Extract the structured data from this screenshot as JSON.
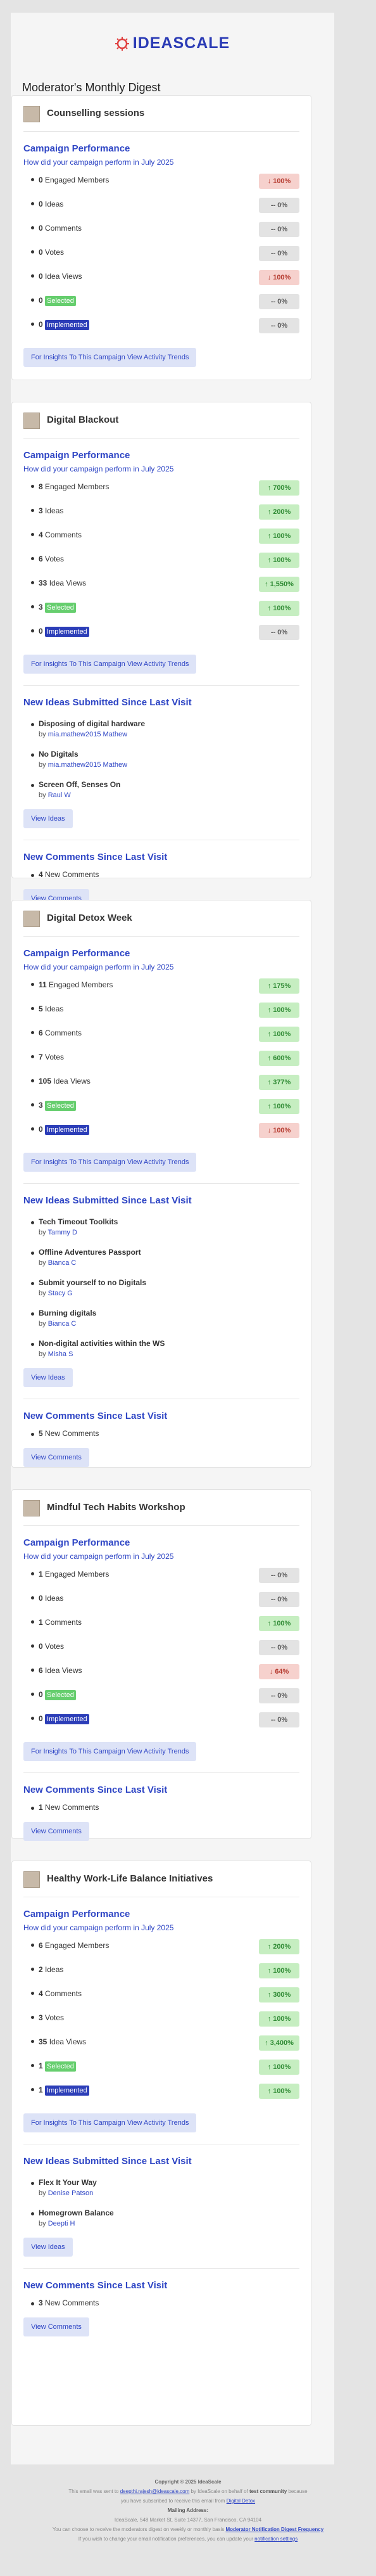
{
  "header": {
    "brand": "IDEASCALE",
    "title": "Moderator's Monthly Digest"
  },
  "labels": {
    "perf_title": "Campaign Performance",
    "perf_subtitle": "How did your campaign perform in July 2025",
    "insights_button": "For Insights To This Campaign View Activity Trends",
    "ideas_title": "New Ideas Submitted Since Last Visit",
    "view_ideas": "View Ideas",
    "comments_title": "New Comments Since Last Visit",
    "view_comments": "View Comments",
    "by": "by"
  },
  "metric_labels": [
    "Engaged Members",
    "Ideas",
    "Comments",
    "Votes",
    "Idea Views",
    "Selected",
    "Implemented"
  ],
  "campaigns": [
    {
      "name": "Counselling sessions",
      "metrics": [
        {
          "value": "0",
          "change": "↓ 100%",
          "trend": "down"
        },
        {
          "value": "0",
          "change": "-- 0%",
          "trend": "flat"
        },
        {
          "value": "0",
          "change": "-- 0%",
          "trend": "flat"
        },
        {
          "value": "0",
          "change": "-- 0%",
          "trend": "flat"
        },
        {
          "value": "0",
          "change": "↓ 100%",
          "trend": "down"
        },
        {
          "value": "0",
          "change": "-- 0%",
          "trend": "flat"
        },
        {
          "value": "0",
          "change": "-- 0%",
          "trend": "flat"
        }
      ]
    },
    {
      "name": "Digital Blackout",
      "metrics": [
        {
          "value": "8",
          "change": "↑ 700%",
          "trend": "up"
        },
        {
          "value": "3",
          "change": "↑ 200%",
          "trend": "up"
        },
        {
          "value": "4",
          "change": "↑ 100%",
          "trend": "up"
        },
        {
          "value": "6",
          "change": "↑ 100%",
          "trend": "up"
        },
        {
          "value": "33",
          "change": "↑ 1,550%",
          "trend": "up"
        },
        {
          "value": "3",
          "change": "↑ 100%",
          "trend": "up"
        },
        {
          "value": "0",
          "change": "-- 0%",
          "trend": "flat"
        }
      ],
      "ideas": [
        {
          "title": "Disposing of digital hardware",
          "author": "mia.mathew2015 Mathew"
        },
        {
          "title": "No Digitals",
          "author": "mia.mathew2015 Mathew"
        },
        {
          "title": "Screen Off, Senses On",
          "author": "Raul W"
        }
      ],
      "comments": {
        "count": "4",
        "label": "New Comments"
      }
    },
    {
      "name": "Digital Detox Week",
      "metrics": [
        {
          "value": "11",
          "change": "↑ 175%",
          "trend": "up"
        },
        {
          "value": "5",
          "change": "↑ 100%",
          "trend": "up"
        },
        {
          "value": "6",
          "change": "↑ 100%",
          "trend": "up"
        },
        {
          "value": "7",
          "change": "↑ 600%",
          "trend": "up"
        },
        {
          "value": "105",
          "change": "↑ 377%",
          "trend": "up"
        },
        {
          "value": "3",
          "change": "↑ 100%",
          "trend": "up"
        },
        {
          "value": "0",
          "change": "↓ 100%",
          "trend": "down"
        }
      ],
      "ideas": [
        {
          "title": "Tech Timeout Toolkits",
          "author": "Tammy D"
        },
        {
          "title": "Offline Adventures Passport",
          "author": "Bianca C"
        },
        {
          "title": "Submit yourself to no Digitals",
          "author": "Stacy G"
        },
        {
          "title": "Burning digitals",
          "author": "Bianca C"
        },
        {
          "title": "Non-digital activities within the WS",
          "author": "Misha S"
        }
      ],
      "comments": {
        "count": "5",
        "label": "New Comments"
      }
    },
    {
      "name": "Mindful Tech Habits Workshop",
      "metrics": [
        {
          "value": "1",
          "change": "-- 0%",
          "trend": "flat"
        },
        {
          "value": "0",
          "change": "-- 0%",
          "trend": "flat"
        },
        {
          "value": "1",
          "change": "↑ 100%",
          "trend": "up"
        },
        {
          "value": "0",
          "change": "-- 0%",
          "trend": "flat"
        },
        {
          "value": "6",
          "change": "↓ 64%",
          "trend": "down"
        },
        {
          "value": "0",
          "change": "-- 0%",
          "trend": "flat"
        },
        {
          "value": "0",
          "change": "-- 0%",
          "trend": "flat"
        }
      ],
      "comments": {
        "count": "1",
        "label": "New Comments"
      }
    },
    {
      "name": "Healthy Work-Life Balance Initiatives",
      "metrics": [
        {
          "value": "6",
          "change": "↑ 200%",
          "trend": "up"
        },
        {
          "value": "2",
          "change": "↑ 100%",
          "trend": "up"
        },
        {
          "value": "4",
          "change": "↑ 300%",
          "trend": "up"
        },
        {
          "value": "3",
          "change": "↑ 100%",
          "trend": "up"
        },
        {
          "value": "35",
          "change": "↑ 3,400%",
          "trend": "up"
        },
        {
          "value": "1",
          "change": "↑ 100%",
          "trend": "up"
        },
        {
          "value": "1",
          "change": "↑ 100%",
          "trend": "up"
        }
      ],
      "ideas": [
        {
          "title": "Flex It Your Way",
          "author": "Denise Patson"
        },
        {
          "title": "Homegrown Balance",
          "author": "Deepti H"
        }
      ],
      "comments": {
        "count": "3",
        "label": "New Comments"
      }
    }
  ],
  "footer": {
    "copyright": "Copyright © 2025 IdeaScale",
    "sent_line_1": "This email was sent to",
    "email": "deepthi.rajesh@ideascale.com",
    "sent_line_2": "by IdeaScale on behalf of",
    "community": "test community",
    "sent_line_3": "because",
    "sent_line_4": "you have subscribed to receive this email from",
    "digest_link": "Digital Detox",
    "mailing_title": "Mailing Address:",
    "address": "IdeaScale, 548 Market St, Suite 14377, San Francisco, CA 94104",
    "unsub_text": "You can choose to receive the moderators digest on weekly or monthly basis",
    "unsub_link": "Moderator Notification Digest Frequency",
    "pref_text": "If you wish to change your email notification preferences, you can update your",
    "pref_link": "notification settings"
  }
}
